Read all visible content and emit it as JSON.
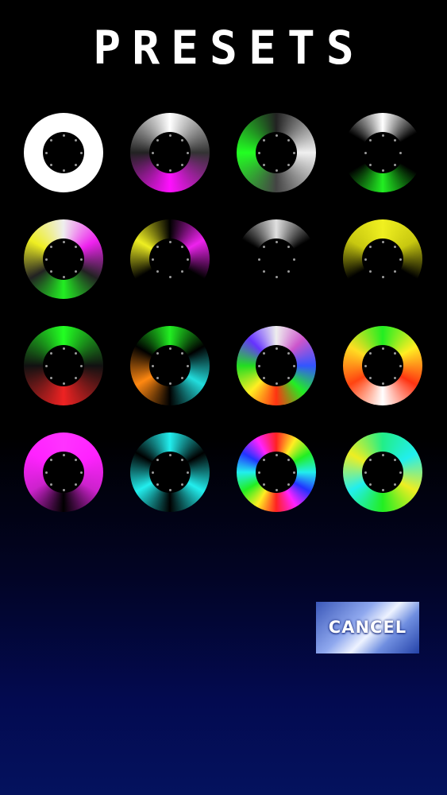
{
  "title": "PRESETS",
  "cancel_label": "CANCEL",
  "presets": [
    {
      "name": "white",
      "stops": [
        "#ffffff",
        "#ffffff",
        "#ffffff",
        "#ffffff"
      ]
    },
    {
      "name": "white-magenta",
      "stops": [
        "#ffffff",
        "#333333",
        "#ff10ff",
        "#222222",
        "#ffffff"
      ]
    },
    {
      "name": "white-green",
      "stops": [
        "#222222",
        "#f0f0f0",
        "#444444",
        "#22ff22",
        "#222222"
      ]
    },
    {
      "name": "white-green-dark",
      "stops": [
        "#ffffff",
        "#000000",
        "#000000",
        "#22ee22",
        "#000000",
        "#000000",
        "#ffffff"
      ]
    },
    {
      "name": "white-magenta-green-yellow",
      "stops": [
        "#eeeeee",
        "#ee22ee",
        "#222222",
        "#22ee22",
        "#222222",
        "#eeee22",
        "#eeeeee"
      ]
    },
    {
      "name": "magenta-yellow",
      "stops": [
        "#000000",
        "#ee22ee",
        "#000000",
        "#000000",
        "#000000",
        "#eeee22",
        "#000000"
      ]
    },
    {
      "name": "white-top",
      "stops": [
        "#e0e0e0",
        "#000000",
        "#000000",
        "#000000",
        "#000000",
        "#000000",
        "#e0e0e0"
      ]
    },
    {
      "name": "yellow-top",
      "stops": [
        "#f0f020",
        "#c8c810",
        "#000000",
        "#000000",
        "#000000",
        "#c8c810",
        "#f0f020"
      ]
    },
    {
      "name": "green-red",
      "stops": [
        "#22ff22",
        "#111111",
        "#ee2222",
        "#111111",
        "#22ff22"
      ]
    },
    {
      "name": "green-cyan-orange",
      "stops": [
        "#22ee22",
        "#000000",
        "#22dddd",
        "#000000",
        "#ff8811",
        "#000000",
        "#22ee22"
      ]
    },
    {
      "name": "rainbow-white",
      "stops": [
        "#eeeeee",
        "#cc55cc",
        "#3355ff",
        "#22ee22",
        "#ff3311",
        "#ffee22",
        "#22dd22",
        "#6633ff",
        "#eeeeee"
      ]
    },
    {
      "name": "green-orange-white",
      "stops": [
        "#22ee22",
        "#ffee22",
        "#ff3311",
        "#ffffff",
        "#ff4411",
        "#ffdd22",
        "#22ee22"
      ]
    },
    {
      "name": "magenta",
      "stops": [
        "#ff33ff",
        "#ff22ff",
        "#cc22cc",
        "#000000",
        "#cc22cc",
        "#ff22ff",
        "#ff33ff"
      ]
    },
    {
      "name": "cyan",
      "stops": [
        "#22eeee",
        "#000000",
        "#22eeee",
        "#000000",
        "#22eeee",
        "#000000",
        "#22eeee"
      ]
    },
    {
      "name": "full-rainbow",
      "stops": [
        "#ff2222",
        "#ffee22",
        "#22ee22",
        "#22eeee",
        "#2233ff",
        "#ff22ff",
        "#ff2222",
        "#ffee22",
        "#22ee22",
        "#22eeee",
        "#2233ff",
        "#ff22ff",
        "#ff2222"
      ]
    },
    {
      "name": "cyan-yellow-green",
      "stops": [
        "#22ee88",
        "#22eeee",
        "#eeee22",
        "#22ee22",
        "#22eeee",
        "#eeee22",
        "#22ee88"
      ]
    }
  ]
}
